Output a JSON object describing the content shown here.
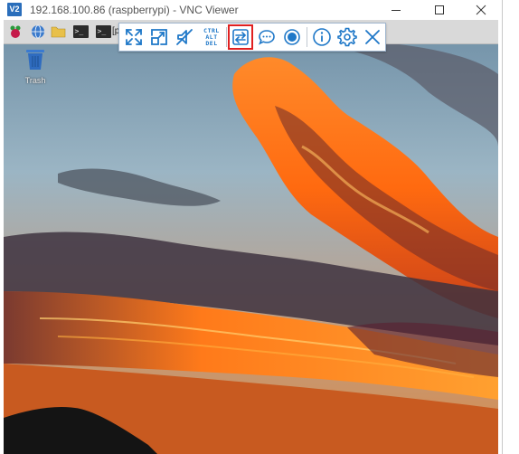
{
  "window": {
    "app_icon_text": "V2",
    "title": "192.168.100.86 (raspberrypi) - VNC Viewer",
    "controls": [
      "minimize",
      "maximize",
      "close"
    ]
  },
  "remote_desktop": {
    "taskbar": {
      "items": [
        {
          "name": "raspberry-menu",
          "icon": "raspberry-icon"
        },
        {
          "name": "web-browser",
          "icon": "globe-icon"
        },
        {
          "name": "file-manager",
          "icon": "folder-icon"
        },
        {
          "name": "terminal",
          "icon": "terminal-icon",
          "glyph": ">_"
        },
        {
          "name": "terminal-window",
          "icon": "terminal-icon",
          "glyph": ">_",
          "label": "[pi"
        }
      ]
    },
    "desktop_icons": [
      {
        "label": "Trash",
        "icon": "trash-icon"
      }
    ]
  },
  "vnc_toolbar": {
    "buttons": [
      {
        "name": "full-screen",
        "icon": "expand-icon"
      },
      {
        "name": "scale",
        "icon": "scale-icon"
      },
      {
        "name": "audio",
        "icon": "mute-icon"
      },
      {
        "name": "ctrl-alt-del",
        "icon": "ctrl-alt-del-icon",
        "lines": [
          "CTRL",
          "ALT",
          "DEL"
        ]
      },
      {
        "name": "file-transfer",
        "icon": "transfer-icon",
        "highlighted": true
      },
      {
        "name": "chat",
        "icon": "chat-icon"
      },
      {
        "name": "record",
        "icon": "record-icon"
      },
      {
        "name": "info",
        "icon": "info-icon"
      },
      {
        "name": "settings",
        "icon": "gear-icon"
      },
      {
        "name": "disconnect",
        "icon": "close-icon"
      }
    ]
  },
  "colors": {
    "accent_blue": "#1f78c8",
    "highlight_red": "#e02020",
    "sky_blue": "#8fb0c8",
    "cloud_orange": "#ff7a1a",
    "cloud_dark": "#3a2a30"
  }
}
